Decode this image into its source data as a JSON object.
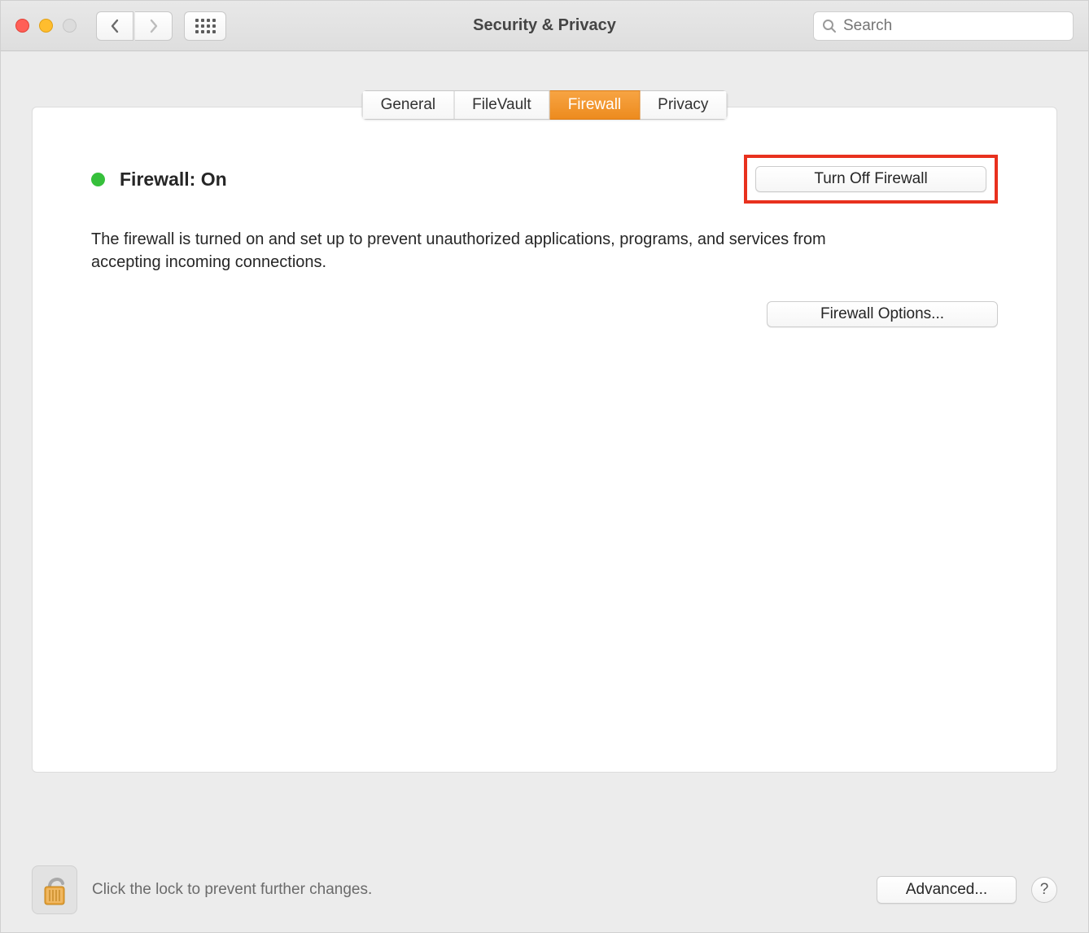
{
  "window": {
    "title": "Security & Privacy"
  },
  "toolbar": {
    "search_placeholder": "Search"
  },
  "tabs": [
    {
      "label": "General",
      "selected": false
    },
    {
      "label": "FileVault",
      "selected": false
    },
    {
      "label": "Firewall",
      "selected": true
    },
    {
      "label": "Privacy",
      "selected": false
    }
  ],
  "firewall": {
    "status_label": "Firewall: On",
    "status_color": "#36c03b",
    "toggle_button": "Turn Off Firewall",
    "description": "The firewall is turned on and set up to prevent unauthorized applications, programs, and services from accepting incoming connections.",
    "options_button": "Firewall Options..."
  },
  "footer": {
    "lock_text": "Click the lock to prevent further changes.",
    "advanced_button": "Advanced...",
    "help_label": "?"
  },
  "highlight": {
    "color": "#e8311e"
  }
}
